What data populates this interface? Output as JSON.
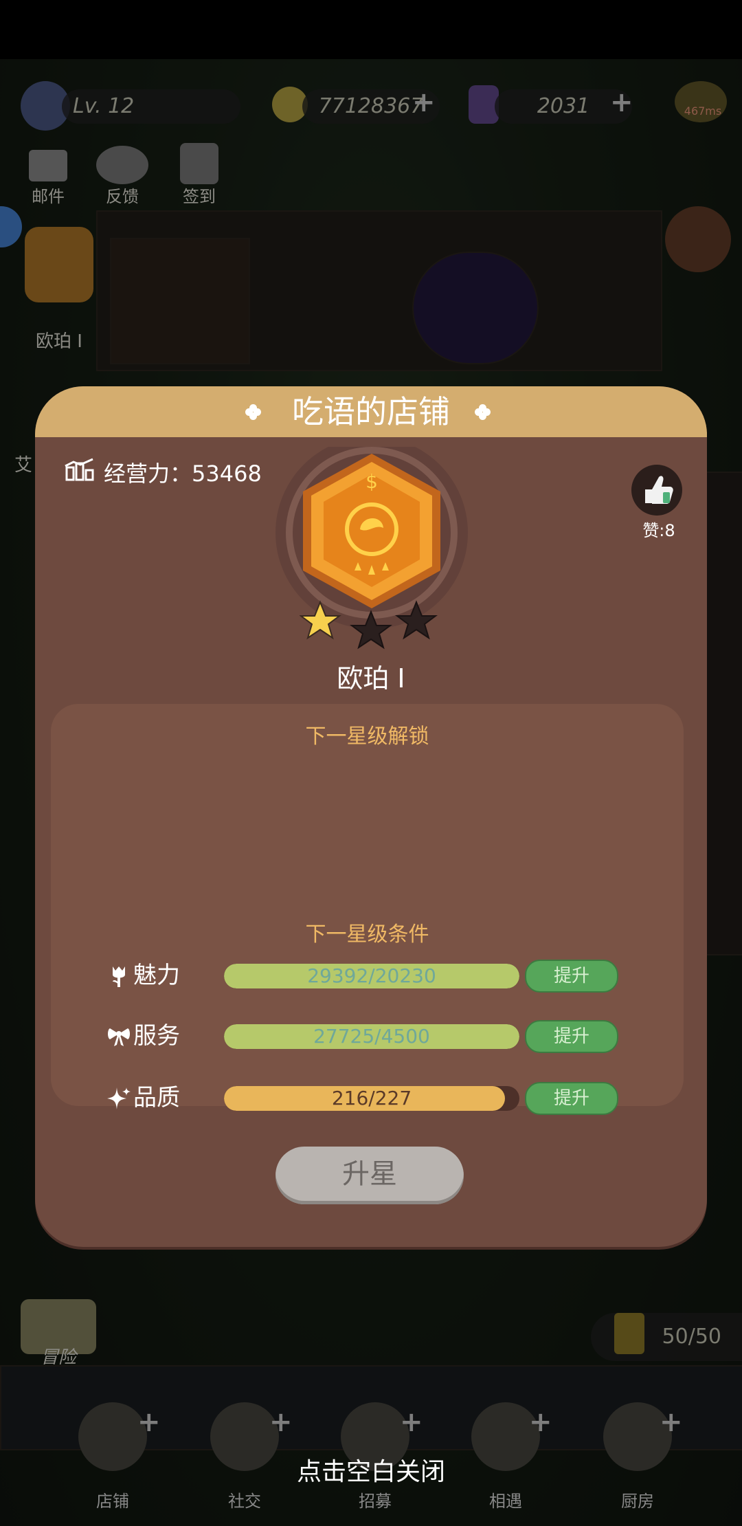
{
  "status_bar": {
    "visible": true
  },
  "hud": {
    "level": "Lv. 12",
    "coins": "77128367",
    "gems": "2031",
    "ping": "467ms",
    "shortcuts": [
      {
        "label": "邮件",
        "icon": "mail-icon"
      },
      {
        "label": "反馈",
        "icon": "planet-icon"
      },
      {
        "label": "签到",
        "icon": "calendar-icon"
      }
    ],
    "side_badge": "欧珀 I",
    "side_badge_2": "艾",
    "energy": "50/50",
    "adventure": "冒险"
  },
  "dialog": {
    "title": "吃语的店铺",
    "power_label": "经营力：53468",
    "likes": "赞:8",
    "rank": "欧珀 I",
    "stars_filled": 1,
    "stars_total": 3,
    "unlock_title": "下一星级解锁",
    "conditions_title": "下一星级条件",
    "stats": [
      {
        "name": "魅力",
        "icon": "tulip-icon",
        "value": "29392/20230",
        "progress": 1.0,
        "color": "#b6c96a",
        "text_color": "#6fa89a",
        "button": "提升"
      },
      {
        "name": "服务",
        "icon": "bow-icon",
        "value": "27725/4500",
        "progress": 1.0,
        "color": "#b6c96a",
        "text_color": "#6fa89a",
        "button": "提升"
      },
      {
        "name": "品质",
        "icon": "sparkle-icon",
        "value": "216/227",
        "progress": 0.95,
        "color": "#e9b65a",
        "text_color": "#5a3a28",
        "button": "提升"
      }
    ],
    "upstar_button": "升星"
  },
  "close_hint": "点击空白关闭",
  "nav": [
    {
      "label": "店铺",
      "icon": "shop-icon"
    },
    {
      "label": "社交",
      "icon": "coffee-icon"
    },
    {
      "label": "招募",
      "icon": "door-icon"
    },
    {
      "label": "相遇",
      "icon": "handshake-icon"
    },
    {
      "label": "厨房",
      "icon": "plate-icon"
    }
  ]
}
